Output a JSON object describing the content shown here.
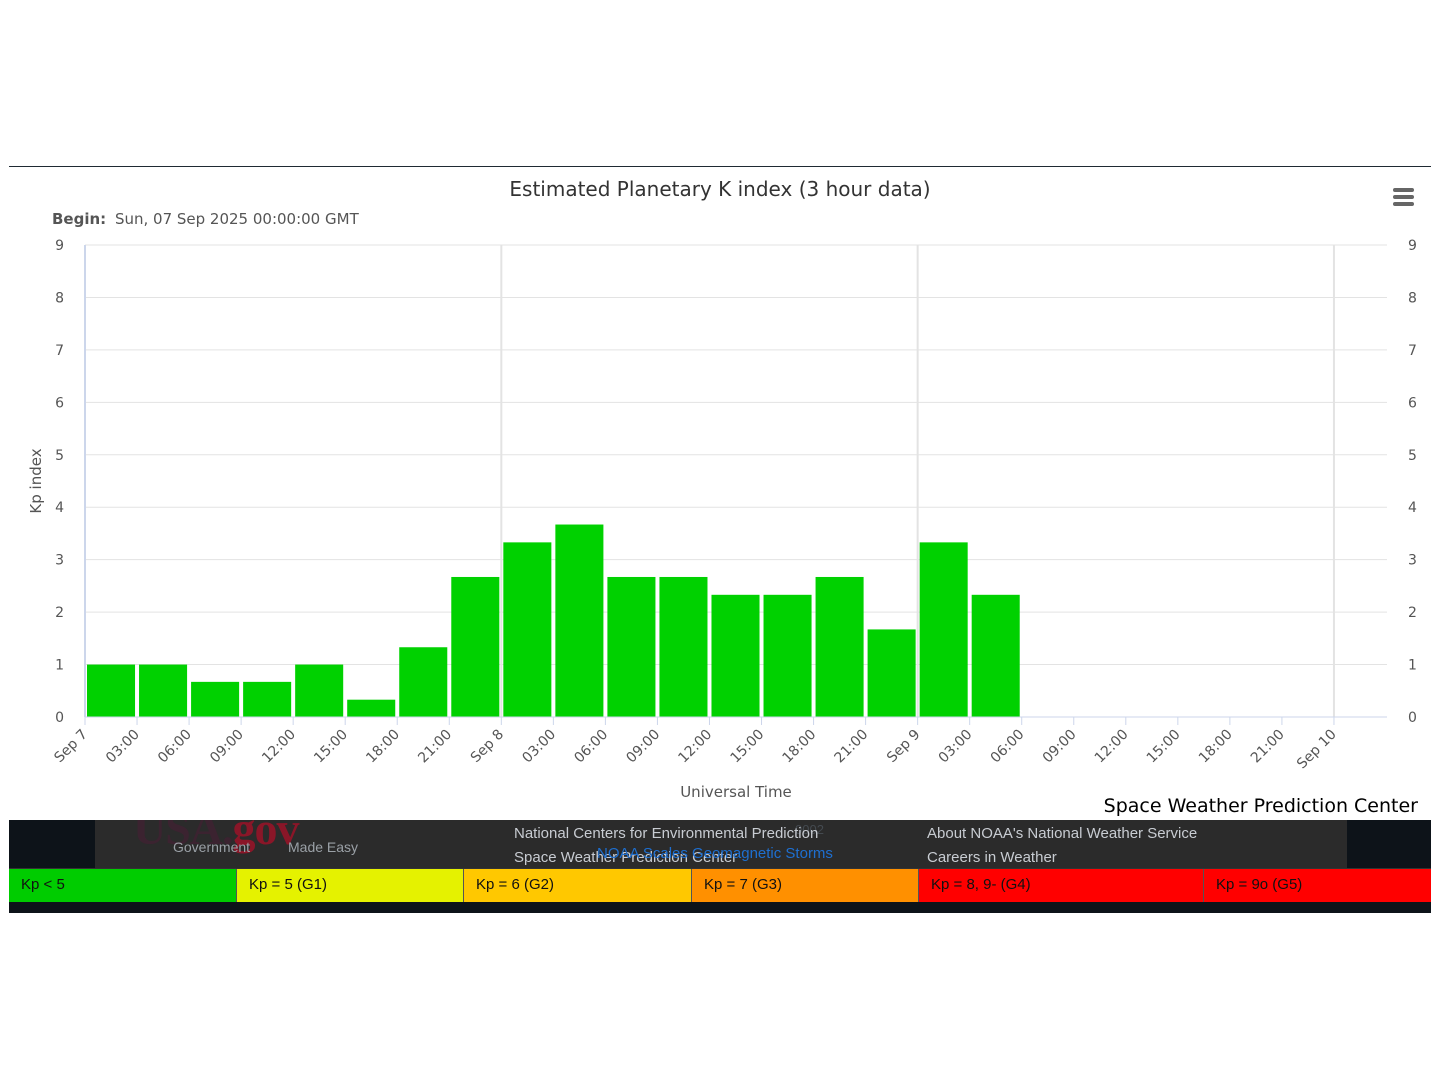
{
  "chart_data": {
    "type": "bar",
    "title": "Estimated Planetary K index (3 hour data)",
    "subtitle_label": "Begin:",
    "subtitle_value": "Sun, 07 Sep 2025 00:00:00 GMT",
    "xlabel": "Universal Time",
    "ylabel": "Kp index",
    "ylim": [
      0,
      9
    ],
    "yticks": [
      "0",
      "1",
      "2",
      "3",
      "4",
      "5",
      "6",
      "7",
      "8",
      "9"
    ],
    "x_tick_labels": [
      "Sep 7",
      "03:00",
      "06:00",
      "09:00",
      "12:00",
      "15:00",
      "18:00",
      "21:00",
      "Sep 8",
      "03:00",
      "06:00",
      "09:00",
      "12:00",
      "15:00",
      "18:00",
      "21:00",
      "Sep 9",
      "03:00",
      "06:00",
      "09:00",
      "12:00",
      "15:00",
      "18:00",
      "21:00",
      "Sep 10"
    ],
    "x_start": "2025-09-07 00:00",
    "x_end": "2025-09-10 00:00",
    "bar_color": "#00d100",
    "grid": true,
    "series": [
      {
        "values": [
          1.0,
          1.0,
          0.67,
          0.67,
          1.0,
          0.33,
          1.33,
          2.67,
          3.33,
          3.67,
          2.67,
          2.67,
          2.33,
          2.33,
          2.67,
          1.67,
          3.33,
          2.33
        ]
      }
    ]
  },
  "credit": "Space Weather Prediction Center",
  "footer": {
    "usa_logo_main": "USA.",
    "usa_logo_gov": "gov",
    "usa_tagline_left": "Government",
    "usa_tagline_right": "Made Easy",
    "link_ncep": "National Centers for Environmental Prediction",
    "link_swpc": "Space Weather Prediction Center",
    "link_about": "About NOAA's National Weather Service",
    "link_careers": "Careers in Weather",
    "overlay_scales": "NOAA Scales Geomagnetic Storms",
    "ghost_updated": "0002"
  },
  "legend": [
    {
      "label": "Kp < 5",
      "color": "#00cc00"
    },
    {
      "label": "Kp = 5 (G1)",
      "color": "#e5f200"
    },
    {
      "label": "Kp = 6 (G2)",
      "color": "#ffc800"
    },
    {
      "label": "Kp = 7 (G3)",
      "color": "#ff9000"
    },
    {
      "label": "Kp = 8, 9- (G4)",
      "color": "#ff0000"
    },
    {
      "label": "Kp = 9o (G5)",
      "color": "#ff0000"
    }
  ]
}
